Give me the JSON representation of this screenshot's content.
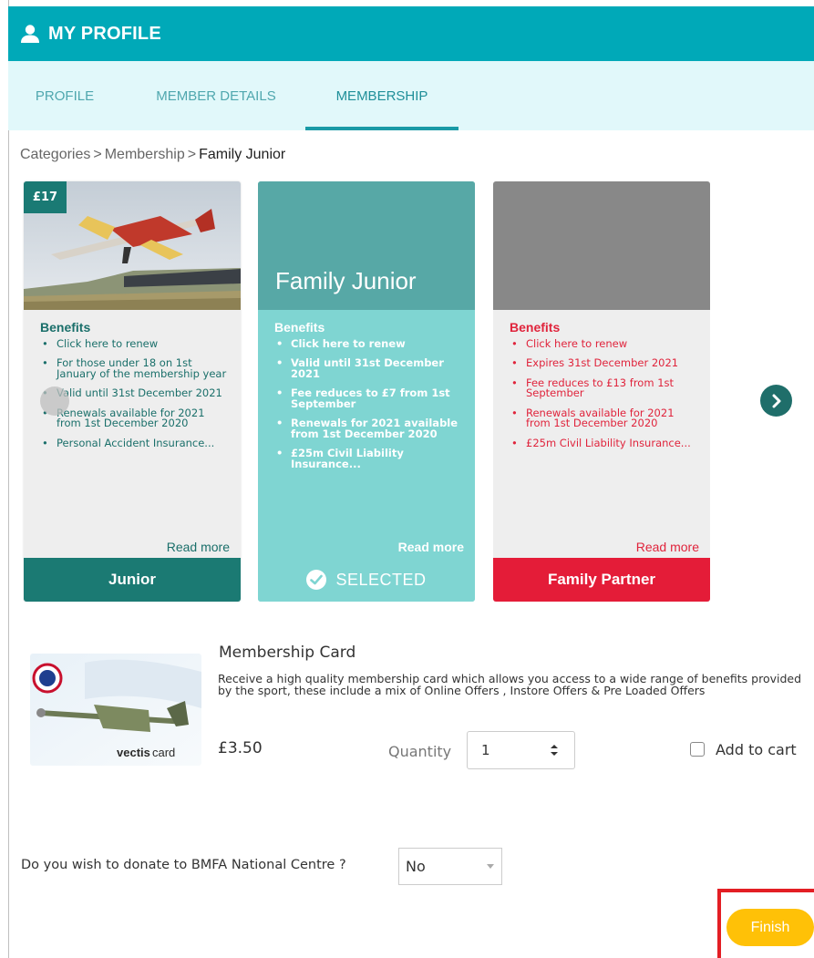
{
  "header": {
    "title": "MY PROFILE",
    "icon": "user-icon"
  },
  "tabs": [
    {
      "label": "PROFILE",
      "active": false
    },
    {
      "label": "MEMBER DETAILS",
      "active": false
    },
    {
      "label": "MEMBERSHIP",
      "active": true
    }
  ],
  "breadcrumb": {
    "items": [
      "Categories",
      "Membership"
    ],
    "current": "Family Junior",
    "separator": ">"
  },
  "cards": [
    {
      "name": "Junior",
      "price": "£17",
      "benefits_title": "Benefits",
      "benefits": [
        "Click here to renew",
        "For those under 18 on 1st January of the membership year",
        "Valid until 31st December 2021",
        "Renewals available for 2021 from 1st December 2020",
        "Personal Accident Insurance..."
      ],
      "read_more": "Read more",
      "color": "#1b7a73"
    },
    {
      "name": "Family Junior",
      "benefits_title": "Benefits",
      "benefits": [
        "Click here to renew",
        "Valid until 31st December 2021",
        "Fee reduces to £7 from 1st September",
        "Renewals for 2021 available from 1st December 2020",
        "£25m Civil Liability Insurance..."
      ],
      "read_more": "Read more",
      "footer": "SELECTED",
      "color": "#7fd5d2"
    },
    {
      "name": "Family Partner",
      "benefits_title": "Benefits",
      "benefits": [
        "Click here to renew",
        "Expires 31st December 2021",
        "Fee reduces to £13 from 1st September",
        "Renewals available for 2021 from 1st December 2020",
        "£25m Civil Liability Insurance..."
      ],
      "read_more": "Read more",
      "color": "#e41c38"
    }
  ],
  "membership_card": {
    "title": "Membership Card",
    "description": "Receive a high quality membership card which allows you access to a wide range of benefits provided by the sport, these include a mix of Online Offers , Instore Offers & Pre Loaded Offers",
    "price": "£3.50",
    "quantity_label": "Quantity",
    "quantity_value": "1",
    "add_to_cart_label": "Add to cart",
    "add_to_cart_checked": false,
    "card_brand": "vectiscard"
  },
  "donate": {
    "question": "Do you wish to donate to BMFA National Centre ?",
    "value": "No"
  },
  "finish_label": "Finish",
  "colors": {
    "header": "#00a9b8",
    "tabs_bg": "#e1f8fa",
    "finish": "#ffc107",
    "highlight": "#e31e24"
  }
}
